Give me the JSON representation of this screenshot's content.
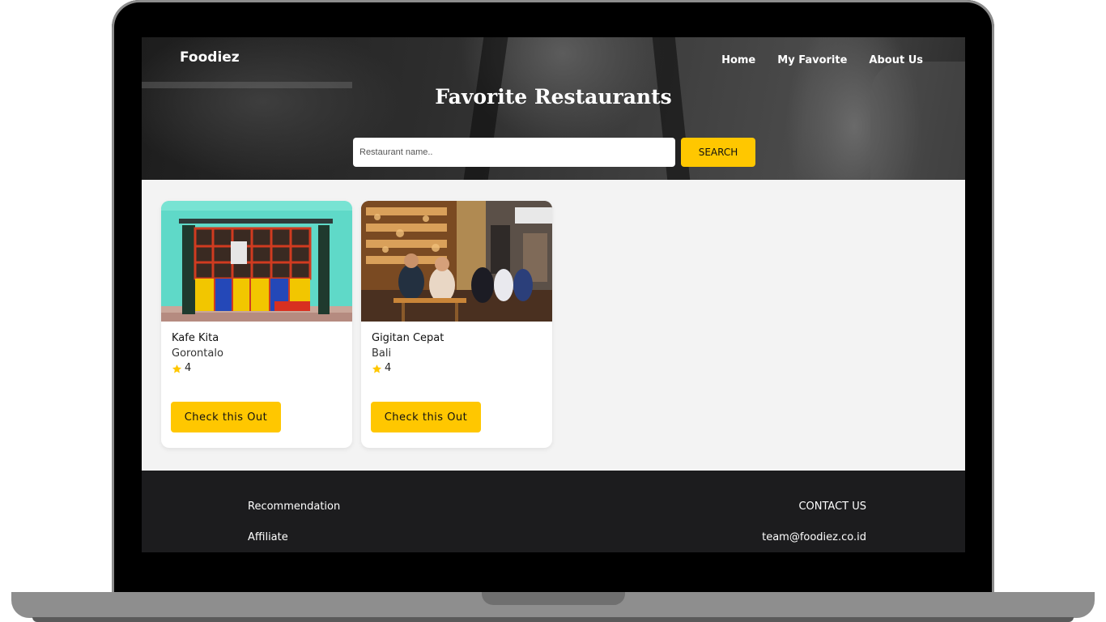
{
  "header": {
    "brand": "Foodiez",
    "nav": [
      "Home",
      "My Favorite",
      "About Us"
    ],
    "title": "Favorite Restaurants"
  },
  "search": {
    "placeholder": "Restaurant name..",
    "button_label": "SEARCH"
  },
  "restaurants": [
    {
      "name": "Kafe Kita",
      "city": "Gorontalo",
      "rating": "4",
      "button_label": "Check this Out"
    },
    {
      "name": "Gigitan Cepat",
      "city": "Bali",
      "rating": "4",
      "button_label": "Check this Out"
    }
  ],
  "footer": {
    "left_links": [
      "Recommendation",
      "Affiliate"
    ],
    "contact_heading": "CONTACT US",
    "contact_email": "team@foodiez.co.id"
  },
  "colors": {
    "accent": "#ffc700",
    "footer_bg": "#1c1c1e",
    "page_bg": "#f3f3f3"
  },
  "icons": {
    "rating": "star-icon"
  }
}
